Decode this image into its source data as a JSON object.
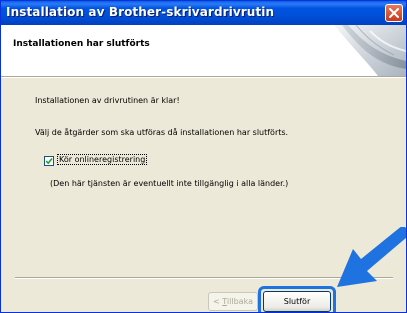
{
  "window": {
    "title": "Installation av Brother-skrivardrivrutin",
    "close_icon": "close-icon"
  },
  "header": {
    "title": "Installationen har slutförts"
  },
  "content": {
    "status_text": "Installationen av drivrutinen är klar!",
    "instruction_text": "Välj de åtgärder som ska utföras då installationen har slutförts.",
    "checkbox_label": "Kör onlineregistrering",
    "checkbox_checked": true,
    "note_text": "(Den här tjänsten är eventuellt inte tillgänglig i alla länder.)"
  },
  "buttons": {
    "back_prefix": "< ",
    "back_accel": "T",
    "back_rest": "illbaka",
    "finish_label": "Slutför"
  },
  "colors": {
    "titlebar": "#0054e3",
    "highlight_arrow": "#1e73e0"
  }
}
